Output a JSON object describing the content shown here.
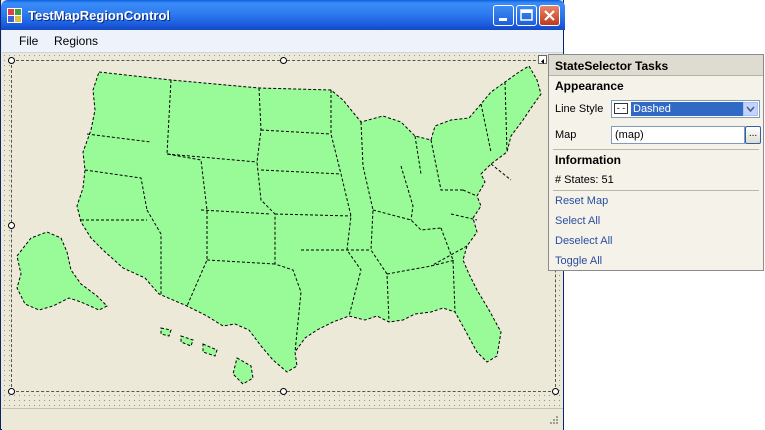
{
  "window": {
    "title": "TestMapRegionControl",
    "colors": {
      "titlebar": "#2f7bf0",
      "map_fill": "#98fb98",
      "link": "#2a4ea1"
    }
  },
  "menu": {
    "file_label": "File",
    "regions_label": "Regions"
  },
  "icons": {
    "app": "app-icon",
    "minimize": "minimize-icon",
    "maximize": "maximize-icon",
    "close": "close-icon",
    "smart_tag": "smart-tag-arrow-icon",
    "dropdown": "chevron-down-icon",
    "grip": "resize-grip-icon"
  },
  "panel": {
    "title": "StateSelector Tasks",
    "appearance": {
      "heading": "Appearance",
      "line_style_label": "Line Style",
      "line_style_value": "Dashed",
      "map_label": "Map",
      "map_value": "(map)",
      "browse_label": "..."
    },
    "information": {
      "heading": "Information",
      "states_count": "# States: 51"
    },
    "actions": [
      "Reset Map",
      "Select All",
      "Deselect All",
      "Toggle All"
    ]
  }
}
